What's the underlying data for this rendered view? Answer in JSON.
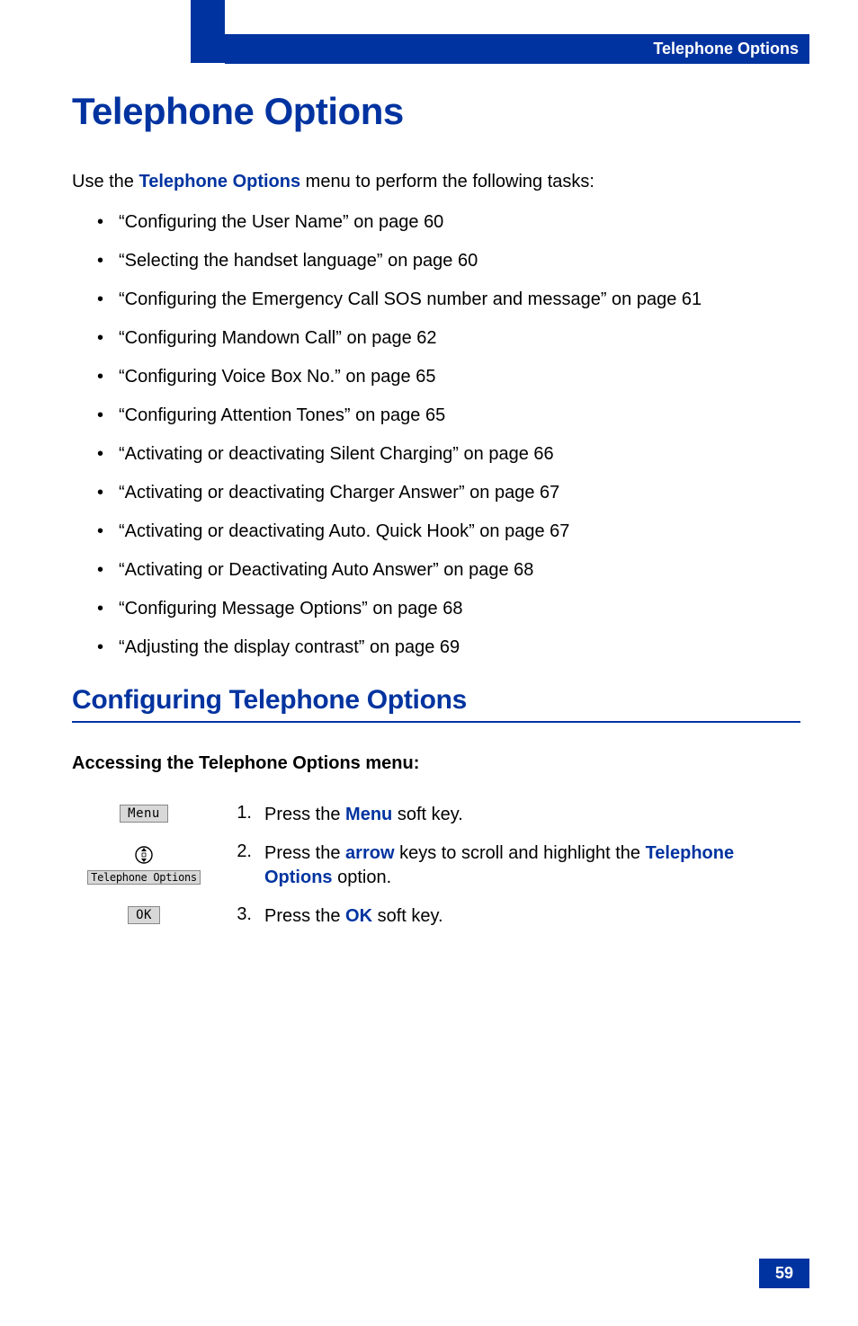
{
  "header": {
    "title": "Telephone Options"
  },
  "main": {
    "title": "Telephone Options",
    "intro_prefix": "Use the ",
    "intro_emphasis": "Telephone Options",
    "intro_suffix": " menu to perform the following tasks:",
    "bullets": [
      "“Configuring the User Name” on page 60",
      "“Selecting the handset language” on page 60",
      "“Configuring the Emergency Call SOS number and message” on page 61",
      "“Configuring Mandown Call” on page 62",
      "“Configuring Voice Box No.” on page 65",
      "“Configuring Attention Tones” on page 65",
      "“Activating or deactivating Silent Charging” on page 66",
      "“Activating or deactivating Charger Answer” on page 67",
      "“Activating or deactivating Auto. Quick Hook” on page 67",
      "“Activating or Deactivating Auto Answer” on page 68",
      "“Configuring Message Options” on page 68",
      "“Adjusting the display contrast” on page 69"
    ],
    "section_heading": "Configuring Telephone Options",
    "sub_heading": "Accessing the Telephone Options menu:",
    "steps": [
      {
        "num": "1.",
        "icon_label": "Menu",
        "text_prefix": "Press the ",
        "text_emph": "Menu",
        "text_suffix": " soft key."
      },
      {
        "num": "2.",
        "icon_label": "Telephone Options",
        "text_prefix": "Press the ",
        "text_emph": "arrow",
        "text_mid": " keys to scroll and highlight the ",
        "text_emph2": "Telephone Options",
        "text_suffix": " option."
      },
      {
        "num": "3.",
        "icon_label": "OK",
        "text_prefix": "Press the ",
        "text_emph": "OK",
        "text_suffix": " soft key."
      }
    ]
  },
  "page_number": "59"
}
